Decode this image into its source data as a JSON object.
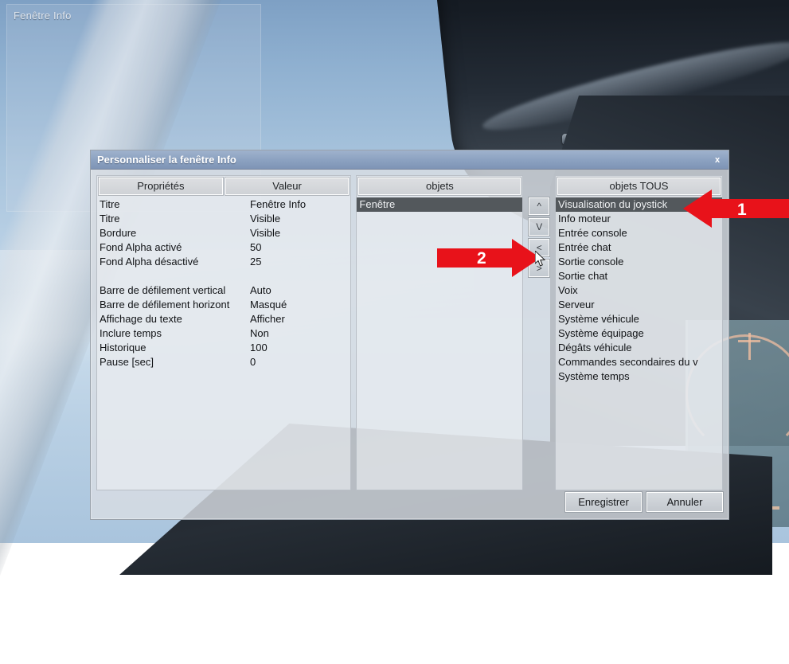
{
  "overlay": {
    "title": "Fenêtre Info"
  },
  "dialog": {
    "title": "Personnaliser la fenêtre Info",
    "close_label": "x",
    "properties_panel": {
      "columns": [
        "Propriétés",
        "Valeur"
      ],
      "rows": [
        {
          "property": "Titre",
          "value": "Fenêtre Info"
        },
        {
          "property": "Titre",
          "value": "Visible"
        },
        {
          "property": "Bordure",
          "value": "Visible"
        },
        {
          "property": "Fond Alpha activé",
          "value": "50"
        },
        {
          "property": "Fond Alpha désactivé",
          "value": "25"
        },
        {
          "property": "",
          "value": ""
        },
        {
          "property": "Barre de défilement vertical",
          "value": "Auto"
        },
        {
          "property": "Barre de défilement horizont",
          "value": "Masqué"
        },
        {
          "property": "Affichage du texte",
          "value": "Afficher"
        },
        {
          "property": "Inclure temps",
          "value": "Non"
        },
        {
          "property": "Historique",
          "value": "100"
        },
        {
          "property": "Pause [sec]",
          "value": "0"
        }
      ]
    },
    "objets_panel": {
      "header": "objets",
      "items": [
        {
          "label": "Fenêtre",
          "selected": true
        }
      ]
    },
    "transfer_buttons": [
      {
        "name": "move-up-button",
        "label": "^"
      },
      {
        "name": "move-down-button",
        "label": "V"
      },
      {
        "name": "add-button",
        "label": "<"
      },
      {
        "name": "remove-button",
        "label": ">"
      }
    ],
    "objets_tous_panel": {
      "header": "objets TOUS",
      "items": [
        {
          "label": "Visualisation du joystick",
          "selected": true
        },
        {
          "label": "Info moteur",
          "selected": false
        },
        {
          "label": "Entrée console",
          "selected": false
        },
        {
          "label": "Entrée chat",
          "selected": false
        },
        {
          "label": "Sortie console",
          "selected": false
        },
        {
          "label": "Sortie chat",
          "selected": false
        },
        {
          "label": "Voix",
          "selected": false
        },
        {
          "label": "Serveur",
          "selected": false
        },
        {
          "label": "Système véhicule",
          "selected": false
        },
        {
          "label": "Système équipage",
          "selected": false
        },
        {
          "label": "Dégâts véhicule",
          "selected": false
        },
        {
          "label": "Commandes secondaires du v",
          "selected": false
        },
        {
          "label": "Système temps",
          "selected": false
        }
      ]
    },
    "footer": {
      "save_label": "Enregistrer",
      "cancel_label": "Annuler"
    }
  },
  "annotations": [
    {
      "number": "1",
      "direction": "left",
      "color": "#e8121a"
    },
    {
      "number": "2",
      "direction": "right",
      "color": "#e8121a"
    }
  ],
  "colors": {
    "annotation_red": "#e8121a",
    "titlebar_blue": "#8da3c2",
    "selection_grey": "#53585c"
  }
}
